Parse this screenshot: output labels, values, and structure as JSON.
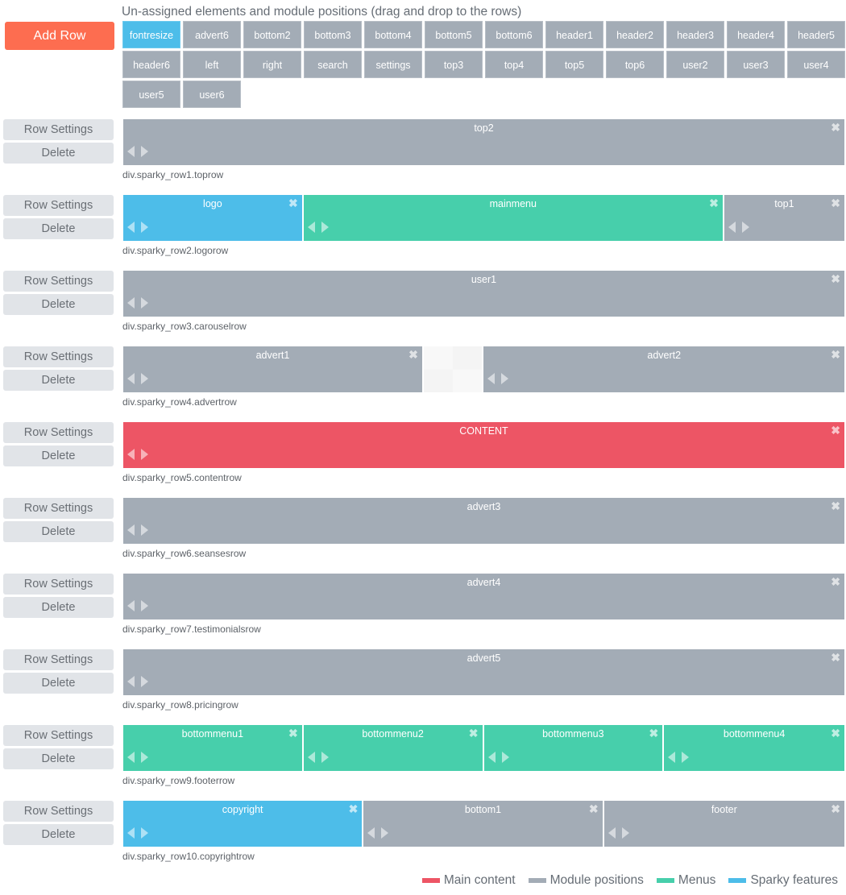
{
  "toolbar": {
    "add_row_label": "Add Row"
  },
  "unassigned": {
    "title": "Un-assigned elements and module positions (drag and drop to the rows)",
    "items": [
      {
        "label": "fontresize",
        "type": "blue"
      },
      {
        "label": "advert6",
        "type": "gray"
      },
      {
        "label": "bottom2",
        "type": "gray"
      },
      {
        "label": "bottom3",
        "type": "gray"
      },
      {
        "label": "bottom4",
        "type": "gray"
      },
      {
        "label": "bottom5",
        "type": "gray"
      },
      {
        "label": "bottom6",
        "type": "gray"
      },
      {
        "label": "header1",
        "type": "gray"
      },
      {
        "label": "header2",
        "type": "gray"
      },
      {
        "label": "header3",
        "type": "gray"
      },
      {
        "label": "header4",
        "type": "gray"
      },
      {
        "label": "header5",
        "type": "gray"
      },
      {
        "label": "header6",
        "type": "gray"
      },
      {
        "label": "left",
        "type": "gray"
      },
      {
        "label": "right",
        "type": "gray"
      },
      {
        "label": "search",
        "type": "gray"
      },
      {
        "label": "settings",
        "type": "gray"
      },
      {
        "label": "top3",
        "type": "gray"
      },
      {
        "label": "top4",
        "type": "gray"
      },
      {
        "label": "top5",
        "type": "gray"
      },
      {
        "label": "top6",
        "type": "gray"
      },
      {
        "label": "user2",
        "type": "gray"
      },
      {
        "label": "user3",
        "type": "gray"
      },
      {
        "label": "user4",
        "type": "gray"
      },
      {
        "label": "user5",
        "type": "gray"
      },
      {
        "label": "user6",
        "type": "gray"
      }
    ]
  },
  "row_buttons": {
    "settings_label": "Row Settings",
    "delete_label": "Delete"
  },
  "rows": [
    {
      "class_name": "div.sparky_row1.toprow",
      "blocks": [
        {
          "label": "top2",
          "type": "gray",
          "span": 12
        }
      ]
    },
    {
      "class_name": "div.sparky_row2.logorow",
      "blocks": [
        {
          "label": "logo",
          "type": "blue",
          "span": 3
        },
        {
          "label": "mainmenu",
          "type": "green",
          "span": 7
        },
        {
          "label": "top1",
          "type": "gray",
          "span": 2
        }
      ]
    },
    {
      "class_name": "div.sparky_row3.carouselrow",
      "blocks": [
        {
          "label": "user1",
          "type": "gray",
          "span": 12
        }
      ]
    },
    {
      "class_name": "div.sparky_row4.advertrow",
      "blocks": [
        {
          "label": "advert1",
          "type": "gray",
          "span": 5
        },
        {
          "label": "",
          "type": "empty",
          "span": 1
        },
        {
          "label": "advert2",
          "type": "gray",
          "span": 6
        }
      ]
    },
    {
      "class_name": "div.sparky_row5.contentrow",
      "blocks": [
        {
          "label": "CONTENT",
          "type": "red",
          "span": 12
        }
      ]
    },
    {
      "class_name": "div.sparky_row6.seansesrow",
      "blocks": [
        {
          "label": "advert3",
          "type": "gray",
          "span": 12
        }
      ]
    },
    {
      "class_name": "div.sparky_row7.testimonialsrow",
      "blocks": [
        {
          "label": "advert4",
          "type": "gray",
          "span": 12
        }
      ]
    },
    {
      "class_name": "div.sparky_row8.pricingrow",
      "blocks": [
        {
          "label": "advert5",
          "type": "gray",
          "span": 12
        }
      ]
    },
    {
      "class_name": "div.sparky_row9.footerrow",
      "blocks": [
        {
          "label": "bottommenu1",
          "type": "green",
          "span": 3
        },
        {
          "label": "bottommenu2",
          "type": "green",
          "span": 3
        },
        {
          "label": "bottommenu3",
          "type": "green",
          "span": 3
        },
        {
          "label": "bottommenu4",
          "type": "green",
          "span": 3
        }
      ]
    },
    {
      "class_name": "div.sparky_row10.copyrightrow",
      "blocks": [
        {
          "label": "copyright",
          "type": "blue",
          "span": 4
        },
        {
          "label": "bottom1",
          "type": "gray",
          "span": 4
        },
        {
          "label": "footer",
          "type": "gray",
          "span": 4
        }
      ]
    }
  ],
  "legend": [
    {
      "label": "Main content",
      "color": "#ed5565"
    },
    {
      "label": "Module positions",
      "color": "#a3acb6"
    },
    {
      "label": "Menus",
      "color": "#47cfab"
    },
    {
      "label": "Sparky features",
      "color": "#4dbde9"
    }
  ]
}
